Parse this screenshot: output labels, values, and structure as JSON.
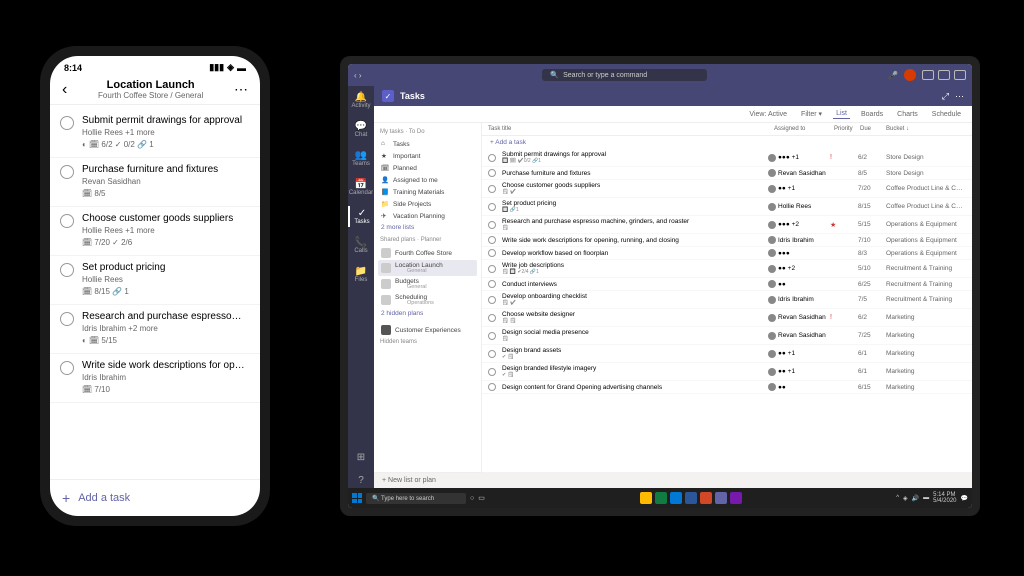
{
  "phone": {
    "status_time": "8:14",
    "title": "Location Launch",
    "subtitle": "Fourth Coffee Store / General",
    "add_task": "Add a task",
    "tasks": [
      {
        "title": "Submit permit drawings for approval",
        "meta": "Hollie Rees +1 more",
        "icons": "◐  🗓 6/2  ✓ 0/2  🔗 1"
      },
      {
        "title": "Purchase furniture and fixtures",
        "meta": "Revan Sasidhan",
        "icons": "🗓 8/5"
      },
      {
        "title": "Choose customer goods suppliers",
        "meta": "Hollie Rees +1 more",
        "icons": "🗓 7/20  ✓ 2/6"
      },
      {
        "title": "Set product pricing",
        "meta": "Hollie Rees",
        "icons": "🗓 8/15  🔗 1"
      },
      {
        "title": "Research and purchase espresso…",
        "meta": "Idris Ibrahim +2 more",
        "icons": "◐  🗓 5/15"
      },
      {
        "title": "Write side work descriptions for op…",
        "meta": "Idris Ibrahim",
        "icons": "🗓 7/10"
      }
    ]
  },
  "tablet": {
    "search_placeholder": "Search or type a command",
    "app_title": "Tasks",
    "rail": [
      "Activity",
      "Chat",
      "Teams",
      "Calendar",
      "Tasks",
      "Calls",
      "Files"
    ],
    "viewbar": {
      "view": "View: Active",
      "filter": "Filter",
      "tabs": [
        "List",
        "Boards",
        "Charts",
        "Schedule"
      ]
    },
    "sidebar": {
      "mytasks_header": "My tasks · To Do",
      "items": [
        "Tasks",
        "Important",
        "Planned",
        "Assigned to me",
        "Training Materials",
        "Side Projects",
        "Vacation Planning"
      ],
      "more": "2 more lists",
      "shared_header": "Shared plans · Planner",
      "plans": [
        {
          "name": "Fourth Coffee Store",
          "sub": ""
        },
        {
          "name": "Location Launch",
          "sub": "General"
        },
        {
          "name": "Budgets",
          "sub": "General"
        },
        {
          "name": "Scheduling",
          "sub": "Operations"
        }
      ],
      "hidden": "2 hidden plans",
      "customer": "Customer Experiences",
      "hidden_teams": "Hidden teams",
      "new_list": "+  New list or plan"
    },
    "columns": {
      "title": "Task title",
      "assigned": "Assigned to",
      "priority": "Priority",
      "due": "Due",
      "bucket": "Bucket ↓"
    },
    "add_row": "+  Add a task",
    "rows": [
      {
        "title": "Submit permit drawings for approval",
        "assn": "●●● +1",
        "pri": "!",
        "due": "6/2",
        "bucket": "Store Design",
        "badges": "🔲 🗓 ✔0/2 🔗1"
      },
      {
        "title": "Purchase furniture and fixtures",
        "assn": "Revan Sasidhan",
        "pri": "",
        "due": "8/5",
        "bucket": "Store Design",
        "badges": ""
      },
      {
        "title": "Choose customer goods suppliers",
        "assn": "●● +1",
        "pri": "",
        "due": "7/20",
        "bucket": "Coffee Product Line & Cust…",
        "badges": "🗒 ✔"
      },
      {
        "title": "Set product pricing",
        "assn": "Hollie Rees",
        "pri": "",
        "due": "8/15",
        "bucket": "Coffee Product Line & Cust…",
        "badges": "🔲 🔗1"
      },
      {
        "title": "Research and purchase espresso machine, grinders, and roaster",
        "assn": "●●● +2",
        "pri": "★",
        "due": "5/15",
        "bucket": "Operations & Equipment",
        "badges": "🗒"
      },
      {
        "title": "Write side work descriptions for opening, running, and closing",
        "assn": "Idris Ibrahim",
        "pri": "",
        "due": "7/10",
        "bucket": "Operations & Equipment",
        "badges": ""
      },
      {
        "title": "Develop workflow based on floorplan",
        "assn": "●●●",
        "pri": "",
        "due": "8/3",
        "bucket": "Operations & Equipment",
        "badges": ""
      },
      {
        "title": "Write job descriptions",
        "assn": "●● +2",
        "pri": "",
        "due": "5/10",
        "bucket": "Recruitment & Training",
        "badges": "🗒 🔲 ✔2/4 🔗1"
      },
      {
        "title": "Conduct interviews",
        "assn": "●●",
        "pri": "",
        "due": "6/25",
        "bucket": "Recruitment & Training",
        "badges": ""
      },
      {
        "title": "Develop onboarding checklist",
        "assn": "Idris Ibrahim",
        "pri": "",
        "due": "7/5",
        "bucket": "Recruitment & Training",
        "badges": "🗒 ✔"
      },
      {
        "title": "Choose website designer",
        "assn": "Revan Sasidhan",
        "pri": "!",
        "due": "6/2",
        "bucket": "Marketing",
        "badges": "🗒 🗒"
      },
      {
        "title": "Design social media presence",
        "assn": "Revan Sasidhan",
        "pri": "",
        "due": "7/25",
        "bucket": "Marketing",
        "badges": "🗒"
      },
      {
        "title": "Design brand assets",
        "assn": "●● +1",
        "pri": "",
        "due": "6/1",
        "bucket": "Marketing",
        "badges": "✔ 🗒"
      },
      {
        "title": "Design branded lifestyle imagery",
        "assn": "●● +1",
        "pri": "",
        "due": "6/1",
        "bucket": "Marketing",
        "badges": "✔ 🗒"
      },
      {
        "title": "Design content for Grand Opening advertising channels",
        "assn": "●●",
        "pri": "",
        "due": "6/15",
        "bucket": "Marketing",
        "badges": ""
      }
    ]
  },
  "windows": {
    "search": "Type here to search",
    "time": "5:14 PM",
    "date": "5/4/2020"
  }
}
